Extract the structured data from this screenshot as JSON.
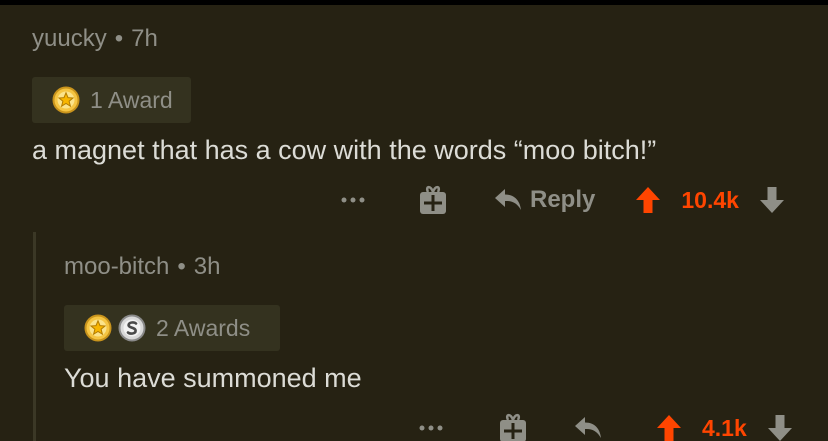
{
  "comments": [
    {
      "username": "yuucky",
      "age": "7h",
      "awards_label": "1 Award",
      "award_icons": [
        "gold-star-award-icon"
      ],
      "body": "a magnet that has a cow with the words “moo bitch!”",
      "actions": {
        "reply_label": "Reply",
        "score": "10.4k"
      }
    },
    {
      "username": "moo-bitch",
      "age": "3h",
      "awards_label": "2 Awards",
      "award_icons": [
        "gold-star-award-icon",
        "silver-s-award-icon"
      ],
      "body": "You have summoned me",
      "actions": {
        "score": "4.1k"
      }
    }
  ],
  "colors": {
    "background": "#262213",
    "upvoted": "#ff4500",
    "muted": "#8f8f87",
    "text": "#dcdcd6",
    "award_chip": "#34321f"
  },
  "meta_separator": "•"
}
